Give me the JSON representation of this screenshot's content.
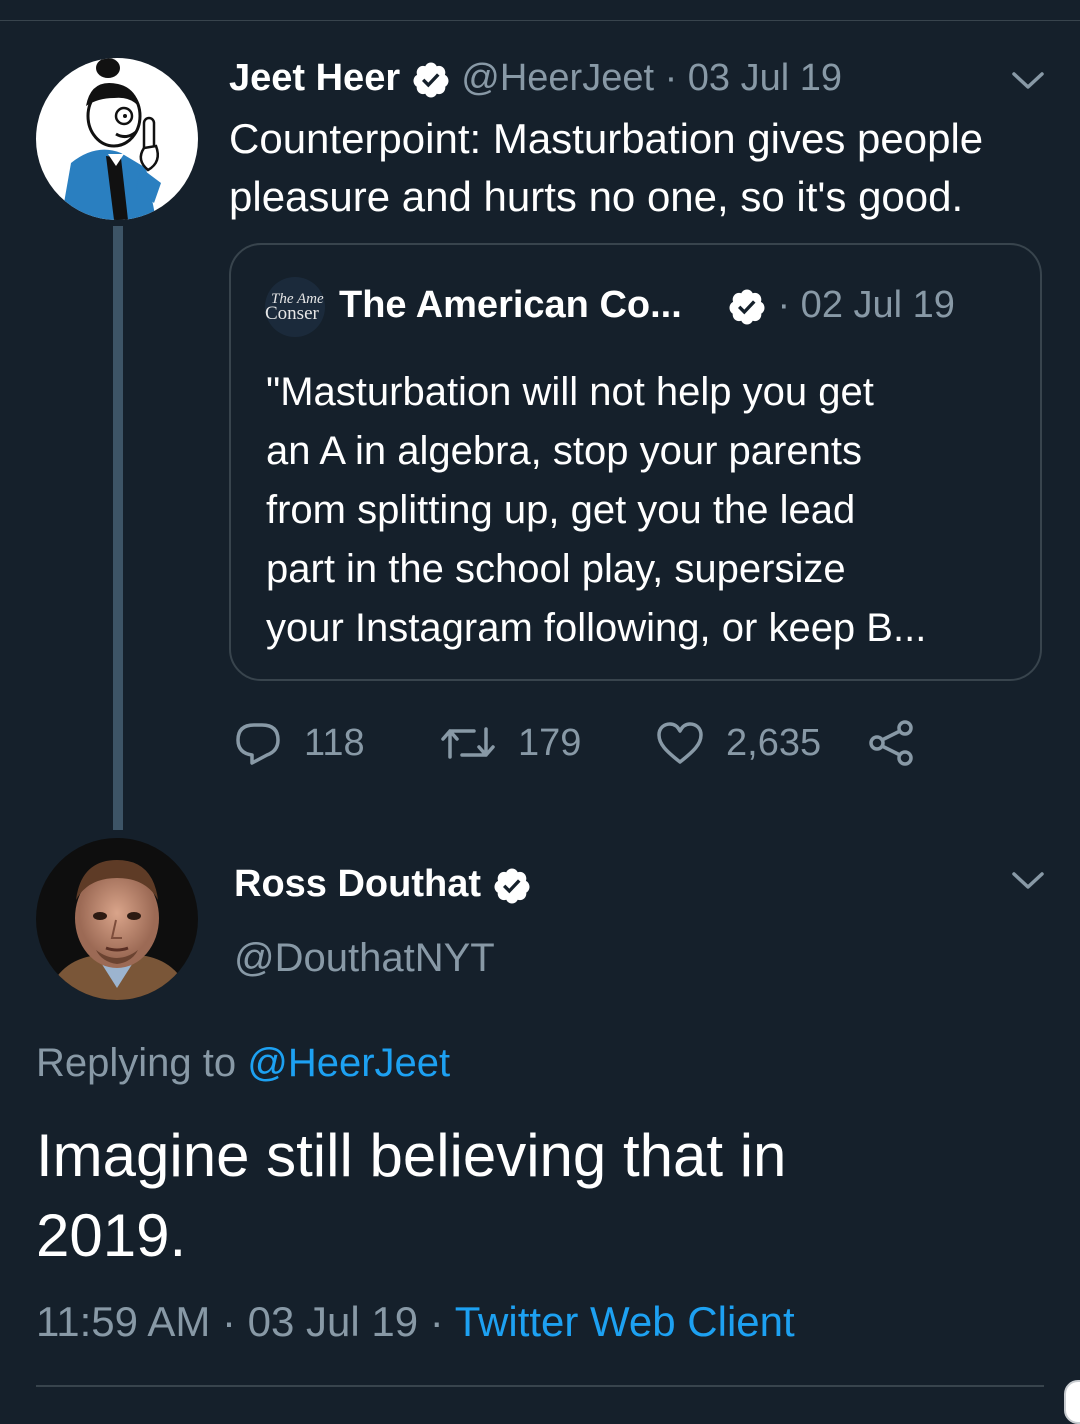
{
  "tweet1": {
    "name": "Jeet Heer",
    "handle": "@HeerJeet",
    "date": "· 03 Jul 19",
    "text_line1": "Counterpoint: Masturbation gives people",
    "text_line2": "pleasure and hurts no one, so it's good.",
    "quote": {
      "avatar_text_line1": "The Ame",
      "avatar_text_line2": "Conser",
      "name": "The American Co...",
      "date": "· 02 Jul 19",
      "lines": [
        "\"Masturbation will not help you get",
        "an A in algebra, stop your parents",
        "from splitting up, get you the lead",
        "part in the school play, supersize",
        "your Instagram following, or keep B..."
      ]
    },
    "actions": {
      "replies": "118",
      "retweets": "179",
      "likes": "2,635"
    }
  },
  "tweet2": {
    "name": "Ross Douthat",
    "handle": "@DouthatNYT",
    "replying_prefix": "Replying to ",
    "replying_to": "@HeerJeet",
    "text_line1": "Imagine still believing that in",
    "text_line2": "2019.",
    "time": "11:59 AM · 03 Jul 19 · ",
    "client": "Twitter Web Client"
  },
  "icons": [
    "verified-badge-icon",
    "chevron-down-icon",
    "reply-icon",
    "retweet-icon",
    "like-icon",
    "share-icon"
  ],
  "colors": {
    "background": "#15202b",
    "muted": "#8899a6",
    "link": "#1da1f2",
    "border": "#38444d"
  }
}
